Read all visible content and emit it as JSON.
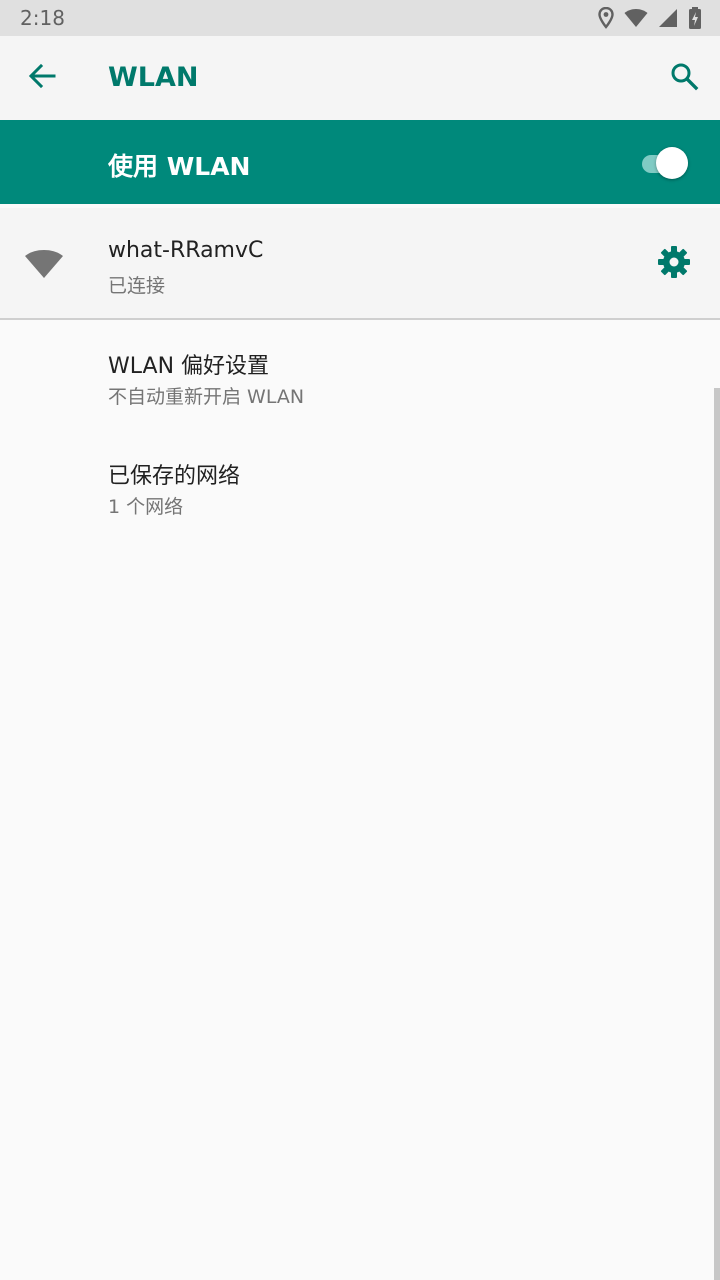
{
  "status_bar": {
    "time": "2:18",
    "icons": [
      "location-icon",
      "wifi-signal-icon",
      "cell-signal-icon",
      "battery-charging-icon"
    ]
  },
  "toolbar": {
    "title": "WLAN",
    "back_icon": "arrow-back-icon",
    "search_icon": "search-icon"
  },
  "master_switch": {
    "label": "使用 WLAN",
    "enabled": true
  },
  "connected_network": {
    "name": "what-RRamvC",
    "status": "已连接",
    "icon": "wifi-icon",
    "settings_icon": "gear-icon"
  },
  "preferences": [
    {
      "title": "WLAN 偏好设置",
      "summary": "不自动重新开启 WLAN"
    },
    {
      "title": "已保存的网络",
      "summary": "1 个网络"
    }
  ],
  "colors": {
    "accent": "#00796b",
    "bar": "#00897b",
    "switch_track": "#80cbc4",
    "icon_grey": "#757575"
  }
}
